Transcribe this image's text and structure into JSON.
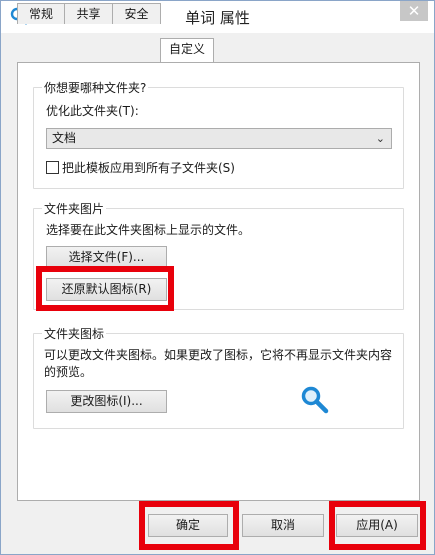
{
  "window": {
    "title": "单词 属性",
    "close_glyph": "✕"
  },
  "tabs": [
    {
      "label": "常规"
    },
    {
      "label": "共享"
    },
    {
      "label": "安全"
    },
    {
      "label": "自定义",
      "active": true
    }
  ],
  "folder_type": {
    "group_label": "你想要哪种文件夹?",
    "optimize_label": "优化此文件夹(T):",
    "selected": "文档",
    "apply_subfolders_label": "把此模板应用到所有子文件夹(S)",
    "apply_subfolders_checked": false
  },
  "folder_picture": {
    "group_label": "文件夹图片",
    "description": "选择要在此文件夹图标上显示的文件。",
    "choose_file_button": "选择文件(F)...",
    "restore_default_button": "还原默认图标(R)"
  },
  "folder_icon": {
    "group_label": "文件夹图标",
    "description_line1": "可以更改文件夹图标。如果更改了图标，它将不再显示文件夹内容",
    "description_line2": "的预览。",
    "change_icon_button": "更改图标(I)..."
  },
  "footer": {
    "ok": "确定",
    "cancel": "取消",
    "apply": "应用(A)"
  },
  "colors": {
    "highlight": "#e8000b",
    "icon_blue": "#1e88d4"
  }
}
